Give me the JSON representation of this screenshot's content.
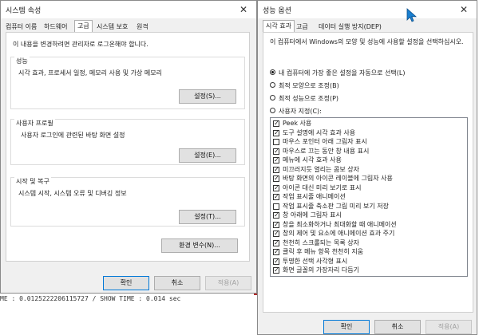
{
  "left_window": {
    "title": "시스템 속성",
    "tabs": [
      "컴퓨터 이름",
      "하드웨어",
      "고급",
      "시스템 보호",
      "원격"
    ],
    "notice": "이 내용을 변경하려면 관리자로 로그온해야 합니다.",
    "performance": {
      "title": "성능",
      "desc": "시각 효과, 프로세서 일정, 메모리 사용 및 가상 메모리",
      "button": "설정(S)..."
    },
    "profile": {
      "title": "사용자 프로필",
      "desc": "사용자 로그인에 관련된 바탕 화면 설정",
      "button": "설정(E)..."
    },
    "startup": {
      "title": "시작 및 복구",
      "desc": "시스템 시작, 시스템 오류 및 디버깅 정보",
      "button": "설정(T)..."
    },
    "env_button": "환경 변수(N)...",
    "ok": "확인",
    "cancel": "취소",
    "apply": "적용(A)"
  },
  "background_text": "ME : 0.0125222206115727 / SHOW TIME : 0.014 sec",
  "right_window": {
    "title": "성능 옵션",
    "tabs": [
      "시각 효과",
      "고급",
      "데이터 실행 방지(DEP)"
    ],
    "desc": "이 컴퓨터에서 Windows의 모양 및 성능에 사용할 설정을 선택하십시오.",
    "radios": [
      {
        "label": "내 컴퓨터에 가장 좋은 설정을 자동으로 선택(L)",
        "checked": true
      },
      {
        "label": "최적 모양으로 조정(B)",
        "checked": false
      },
      {
        "label": "최적 성능으로 조정(P)",
        "checked": false
      },
      {
        "label": "사용자 지정(C):",
        "checked": false
      }
    ],
    "options": [
      {
        "label": "Peek 사용",
        "checked": true
      },
      {
        "label": "도구 설명에 시각 효과 사용",
        "checked": true
      },
      {
        "label": "마우스 포인터 아래 그림자 표시",
        "checked": false
      },
      {
        "label": "마우스로 끄는 동안 창 내용 표시",
        "checked": true
      },
      {
        "label": "메뉴에 시각 효과 사용",
        "checked": true
      },
      {
        "label": "미끄러지듯 열리는 콤보 상자",
        "checked": true
      },
      {
        "label": "바탕 화면의 아이콘 레이블에 그림자 사용",
        "checked": true
      },
      {
        "label": "아이콘 대신 미리 보기로 표시",
        "checked": true
      },
      {
        "label": "작업 표시줄 애니메이션",
        "checked": true
      },
      {
        "label": "작업 표시줄 축소판 그림 미리 보기 저장",
        "checked": false
      },
      {
        "label": "창 아래에 그림자 표시",
        "checked": true
      },
      {
        "label": "창을 최소화하거나 최대화할 때 애니메이션",
        "checked": true
      },
      {
        "label": "창의 제어 및 요소에 애니메이션 효과 주기",
        "checked": true
      },
      {
        "label": "천천히 스크롤되는 목록 상자",
        "checked": true
      },
      {
        "label": "클릭 후 메뉴 항목 천천히 지움",
        "checked": true
      },
      {
        "label": "투명한 선택 사각형 표시",
        "checked": true
      },
      {
        "label": "화면 글꼴의 가장자리 다듬기",
        "checked": true
      }
    ],
    "ok": "확인",
    "cancel": "취소",
    "apply": "적용(A)"
  },
  "colors": {
    "accent": "#0078d7",
    "cursor": "#1a7fd0",
    "strip": "#b02a2a"
  }
}
